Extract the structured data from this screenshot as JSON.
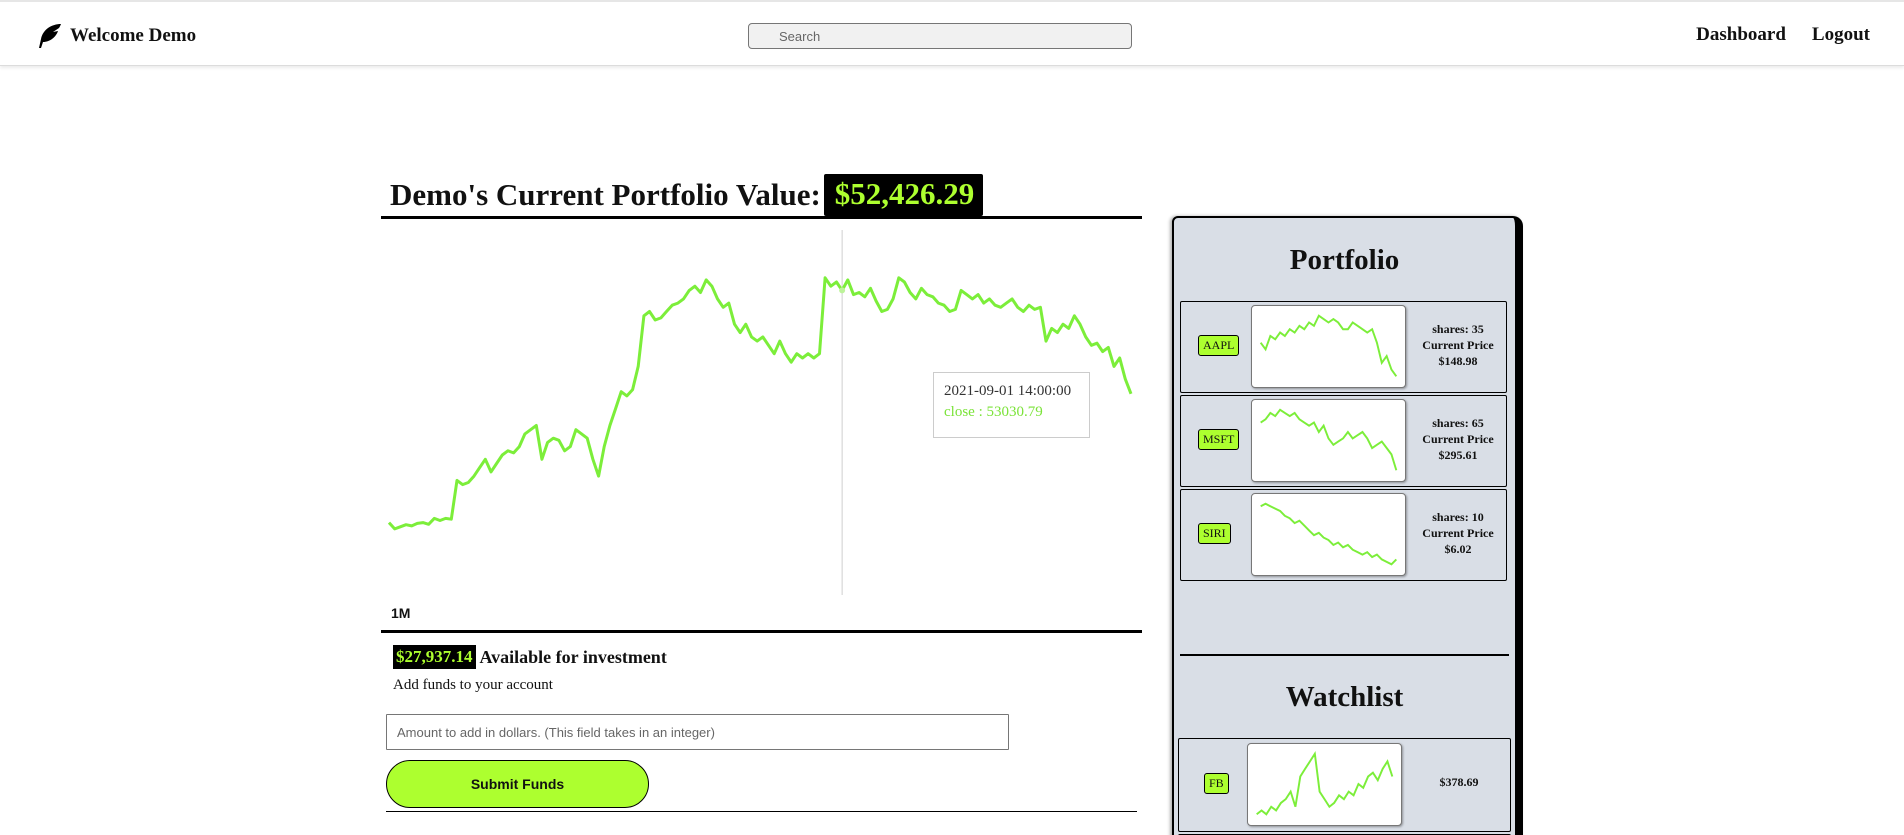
{
  "navbar": {
    "brand": "Welcome Demo",
    "search_placeholder": "Search",
    "links": [
      "Dashboard",
      "Logout"
    ]
  },
  "portfolio": {
    "title_label": "Demo's Current Portfolio Value:",
    "value": "$52,426.29",
    "range": "1M",
    "tooltip": {
      "date": "2021-09-01 14:00:00",
      "close": "close : 53030.79"
    }
  },
  "funds": {
    "available_amount": "$27,937.14",
    "available_label": "Available for investment",
    "add_funds_label": "Add funds to your account",
    "amount_placeholder": "Amount to add in dollars. (This field takes in an integer)",
    "submit_label": "Submit Funds"
  },
  "sidebar": {
    "portfolio_title": "Portfolio",
    "watchlist_title": "Watchlist",
    "holdings": [
      {
        "ticker": "AAPL",
        "shares": "shares: 35",
        "price_label": "Current Price",
        "price": "$148.98"
      },
      {
        "ticker": "MSFT",
        "shares": "shares: 65",
        "price_label": "Current Price",
        "price": "$295.61"
      },
      {
        "ticker": "SIRI",
        "shares": "shares: 10",
        "price_label": "Current Price",
        "price": "$6.02"
      }
    ],
    "watchlist": [
      {
        "ticker": "FB",
        "price": "$378.69"
      }
    ]
  },
  "colors": {
    "accent": "#adff2f",
    "line": "#7cee3a",
    "sidebar_bg": "#d9dee6"
  },
  "chart_data": {
    "type": "line",
    "title": "",
    "series": [
      {
        "values": [
          42600,
          42450,
          42500,
          42550,
          42520,
          42580,
          42600,
          42560,
          42700,
          42650,
          42700,
          42680,
          43600,
          43500,
          43550,
          43700,
          43900,
          44100,
          43800,
          44000,
          44200,
          44300,
          44250,
          44400,
          44700,
          44800,
          44900,
          44100,
          44500,
          44600,
          44550,
          44300,
          44400,
          44800,
          44700,
          44600,
          44100,
          43700,
          44400,
          44900,
          45300,
          45700,
          45600,
          45750,
          46300,
          47500,
          47600,
          47400,
          47450,
          47600,
          47750,
          47800,
          47900,
          48100,
          48200,
          48050,
          48350,
          48200,
          47900,
          47700,
          47800,
          47300,
          47100,
          47300,
          47000,
          46900,
          47000,
          46800,
          46600,
          46900,
          46600,
          46400,
          46600,
          46500,
          46600,
          46500,
          46600,
          48400,
          48200,
          48300,
          48100,
          48350,
          48000,
          48050,
          47950,
          48150,
          47850,
          47600,
          47650,
          47900,
          48400,
          48300,
          48050,
          47900,
          48150,
          48000,
          47950,
          47800,
          47750,
          47600,
          47650,
          48100,
          48000,
          47900,
          48000,
          47800,
          47900,
          47750,
          47700,
          47800,
          47900,
          47700,
          47600,
          47750,
          47650,
          47700,
          46900,
          47200,
          47100,
          47300,
          47200,
          47500,
          47300,
          47000,
          46800,
          46850,
          46650,
          46750,
          46300,
          46500,
          46000,
          45650
        ]
      }
    ],
    "ylim": [
      41500,
      49200
    ],
    "grid": false,
    "tooltip_index": 80
  },
  "sparklines": {
    "AAPL": [
      50,
      48,
      52,
      51,
      53,
      52,
      54,
      53,
      55,
      54,
      56,
      55,
      58,
      57,
      56,
      57,
      56,
      54,
      54,
      56,
      55,
      54,
      53,
      54,
      50,
      44,
      46,
      42,
      40
    ],
    "MSFT": [
      55,
      56,
      58,
      57,
      59,
      58,
      57,
      58,
      56,
      55,
      54,
      55,
      52,
      54,
      50,
      48,
      49,
      50,
      52,
      50,
      51,
      52,
      50,
      47,
      48,
      49,
      47,
      45,
      40
    ],
    "SIRI": [
      60,
      61,
      60,
      59,
      58,
      56,
      55,
      53,
      54,
      52,
      50,
      48,
      49,
      47,
      46,
      44,
      45,
      43,
      44,
      42,
      41,
      40,
      41,
      39,
      40,
      38,
      37,
      36,
      38
    ],
    "FB": [
      40,
      41,
      40,
      42,
      41,
      43,
      44,
      46,
      42,
      50,
      52,
      54,
      56,
      46,
      44,
      42,
      43,
      45,
      44,
      46,
      45,
      48,
      47,
      50,
      51,
      49,
      52,
      54,
      50
    ]
  }
}
